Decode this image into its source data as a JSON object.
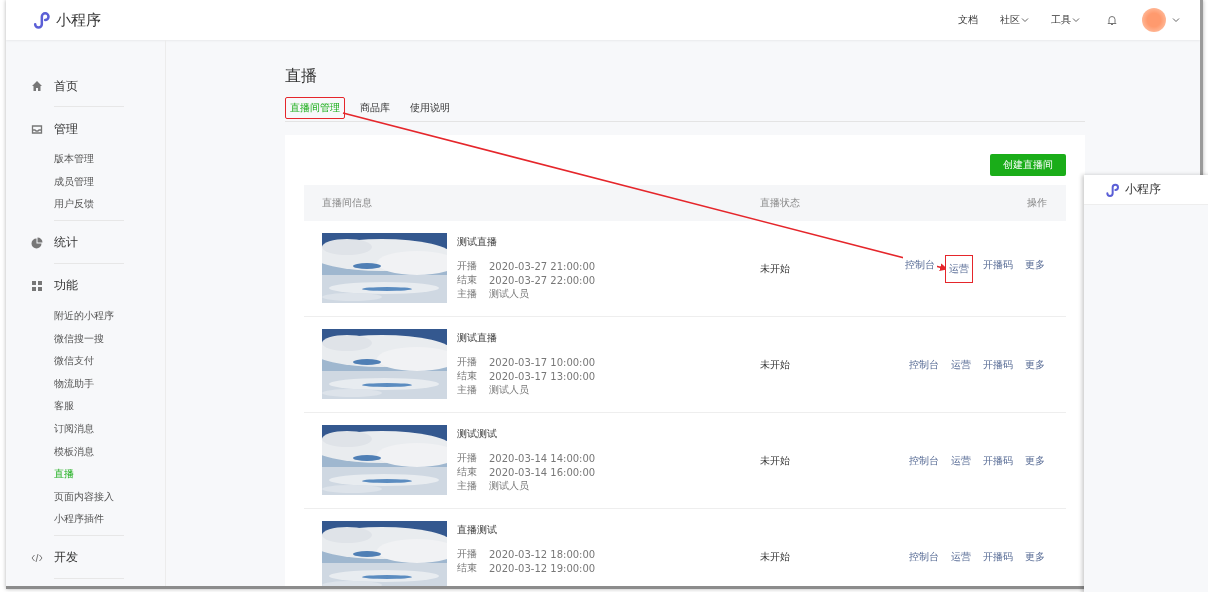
{
  "window": {
    "logo_text": "小程序"
  },
  "header_nav": [
    {
      "label": "文档",
      "dropdown": false
    },
    {
      "label": "社区",
      "dropdown": true
    },
    {
      "label": "工具",
      "dropdown": true
    }
  ],
  "sidebar": [
    {
      "kind": "home",
      "label": "首页"
    },
    {
      "kind": "inbox",
      "label": "管理",
      "children": [
        {
          "label": "版本管理",
          "selected": false
        },
        {
          "label": "成员管理",
          "selected": false
        },
        {
          "label": "用户反馈",
          "selected": false
        }
      ]
    },
    {
      "kind": "chart",
      "label": "统计"
    },
    {
      "kind": "grid",
      "label": "功能",
      "children": [
        {
          "label": "附近的小程序",
          "selected": false
        },
        {
          "label": "微信搜一搜",
          "selected": false
        },
        {
          "label": "微信支付",
          "selected": false
        },
        {
          "label": "物流助手",
          "selected": false
        },
        {
          "label": "客服",
          "selected": false
        },
        {
          "label": "订阅消息",
          "selected": false
        },
        {
          "label": "模板消息",
          "selected": false
        },
        {
          "label": "直播",
          "selected": true
        },
        {
          "label": "页面内容接入",
          "selected": false
        },
        {
          "label": "小程序插件",
          "selected": false
        }
      ]
    },
    {
      "kind": "code",
      "label": "开发"
    }
  ],
  "page": {
    "title": "直播",
    "tabs": [
      {
        "label": "直播间管理",
        "selected": true,
        "highlighted": true
      },
      {
        "label": "商品库",
        "selected": false,
        "highlighted": false
      },
      {
        "label": "使用说明",
        "selected": false,
        "highlighted": false
      }
    ],
    "create_button": "创建直播间"
  },
  "table": {
    "columns": [
      "直播间信息",
      "直播状态",
      "操作"
    ],
    "rows": [
      {
        "thumbnail": {
          "kind": "picture"
        },
        "title": "测试直播",
        "details": [
          {
            "label": "开播",
            "value": "2020-03-27 21:00:00"
          },
          {
            "label": "结束",
            "value": "2020-03-27 22:00:00"
          },
          {
            "label": "主播",
            "value": "测试人员"
          }
        ],
        "status": "未开始",
        "actions": [
          {
            "label": "控制台",
            "highlighted": false
          },
          {
            "label": "运营",
            "highlighted": true
          },
          {
            "label": "开播码",
            "highlighted": false
          },
          {
            "label": "更多",
            "highlighted": false
          }
        ]
      },
      {
        "thumbnail": {
          "kind": "picture"
        },
        "title": "测试直播",
        "details": [
          {
            "label": "开播",
            "value": "2020-03-17 10:00:00"
          },
          {
            "label": "结束",
            "value": "2020-03-17 13:00:00"
          },
          {
            "label": "主播",
            "value": "测试人员"
          }
        ],
        "status": "未开始",
        "actions": [
          {
            "label": "控制台",
            "highlighted": false
          },
          {
            "label": "运营",
            "highlighted": false
          },
          {
            "label": "开播码",
            "highlighted": false
          },
          {
            "label": "更多",
            "highlighted": false
          }
        ]
      },
      {
        "thumbnail": {
          "kind": "picture"
        },
        "title": "测试测试",
        "details": [
          {
            "label": "开播",
            "value": "2020-03-14 14:00:00"
          },
          {
            "label": "结束",
            "value": "2020-03-14 16:00:00"
          },
          {
            "label": "主播",
            "value": "测试人员"
          }
        ],
        "status": "未开始",
        "actions": [
          {
            "label": "控制台",
            "highlighted": false
          },
          {
            "label": "运营",
            "highlighted": false
          },
          {
            "label": "开播码",
            "highlighted": false
          },
          {
            "label": "更多",
            "highlighted": false
          }
        ]
      },
      {
        "thumbnail": {
          "kind": "picture"
        },
        "title": "直播测试",
        "details": [
          {
            "label": "开播",
            "value": "2020-03-12 18:00:00"
          },
          {
            "label": "结束",
            "value": "2020-03-12 19:00:00"
          }
        ],
        "status": "未开始",
        "actions": [
          {
            "label": "控制台",
            "highlighted": false
          },
          {
            "label": "运营",
            "highlighted": false
          },
          {
            "label": "开播码",
            "highlighted": false
          },
          {
            "label": "更多",
            "highlighted": false
          }
        ]
      }
    ]
  },
  "annotation_arrow": true,
  "overlay_window": {
    "logo_text": "小程序"
  }
}
